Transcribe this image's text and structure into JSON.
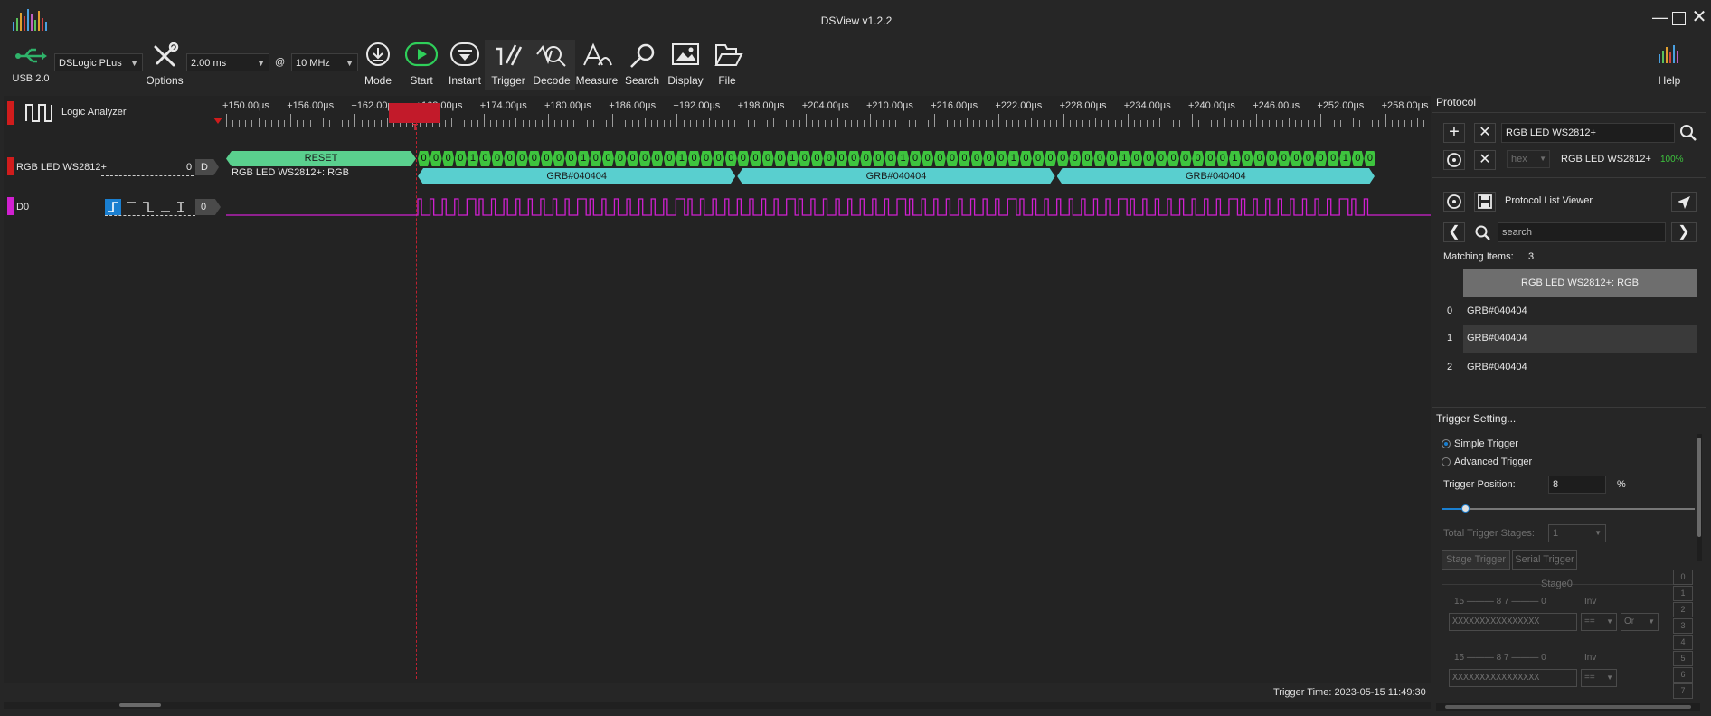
{
  "window": {
    "title": "DSView v1.2.2"
  },
  "toolbar": {
    "usb_label": "USB 2.0",
    "device": "DSLogic PLus",
    "options_label": "Options",
    "sample_time": "2.00 ms",
    "at": "@",
    "sample_rate": "10 MHz",
    "buttons": [
      "Mode",
      "Start",
      "Instant",
      "Trigger",
      "Decode",
      "Measure",
      "Search",
      "Display",
      "File"
    ],
    "help_label": "Help"
  },
  "ruler": {
    "labels": [
      "+150.00µs",
      "+156.00µs",
      "+162.00µs",
      "+168.00µs",
      "+174.00µs",
      "+180.00µs",
      "+186.00µs",
      "+192.00µs",
      "+198.00µs",
      "+204.00µs",
      "+210.00µs",
      "+216.00µs",
      "+222.00µs",
      "+228.00µs",
      "+234.00µs",
      "+240.00µs",
      "+246.00µs",
      "+252.00µs",
      "+258.00µs"
    ],
    "marker": "T"
  },
  "channels": {
    "analyzer": {
      "name": "Logic Analyzer"
    },
    "decoder": {
      "name": "RGB LED WS2812+",
      "index": "0",
      "badge": "D",
      "reset_label": "RESET",
      "row_label": "RGB LED WS2812+: RGB",
      "bits": "000010000000010000000100000000100000000100000000100000000100000000100000000100",
      "segments": [
        "GRB#040404",
        "GRB#040404",
        "GRB#040404"
      ]
    },
    "d0": {
      "name": "D0",
      "index": "0"
    }
  },
  "status": {
    "trigger_time": "Trigger Time: 2023-05-15 11:49:30"
  },
  "protocol": {
    "header": "Protocol",
    "decoder_input": "RGB LED WS2812+",
    "format": "hex",
    "decoder_name": "RGB LED WS2812+",
    "decoder_pct": "100%",
    "list_viewer_label": "Protocol List Viewer",
    "search_placeholder": "search",
    "matching_label": "Matching Items:",
    "matching_count": "3",
    "column_header": "RGB LED WS2812+: RGB",
    "rows": [
      {
        "index": "0",
        "value": "GRB#040404"
      },
      {
        "index": "1",
        "value": "GRB#040404"
      },
      {
        "index": "2",
        "value": "GRB#040404"
      }
    ]
  },
  "trigger": {
    "header": "Trigger Setting...",
    "simple": "Simple Trigger",
    "advanced": "Advanced Trigger",
    "position_label": "Trigger Position:",
    "position_value": "8",
    "position_unit": "%",
    "total_stages_label": "Total Trigger Stages:",
    "total_stages_value": "1",
    "tab_stage": "Stage Trigger",
    "tab_serial": "Serial Trigger",
    "stage_name": "Stage0",
    "bit_range": "15 ——— 8 7 ——— 0",
    "inv_label": "Inv",
    "pattern": "XXXXXXXXXXXXXXXX",
    "op_eq": "==",
    "op_or": "Or",
    "stage_tabs": [
      "0",
      "1",
      "2",
      "3",
      "4",
      "5",
      "6",
      "7"
    ]
  },
  "colors": {
    "decoder_green": "#5ad08e",
    "bit_green": "#3ec43e",
    "segment_cyan": "#59cfcf",
    "d0_magenta": "#d020d0",
    "channel_red": "#d01c1c",
    "accent_blue": "#1a7fd0"
  }
}
